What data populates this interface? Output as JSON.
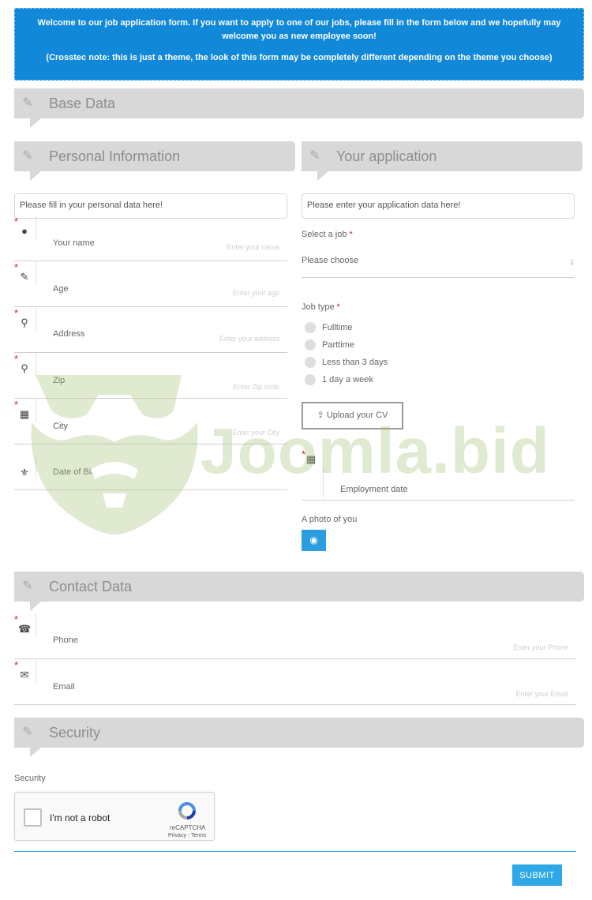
{
  "intro": {
    "line1": "Welcome to our job application form. If you want to apply to one of our jobs, please fill in the form below and we hopefully may welcome you as new employee soon!",
    "line2": "(Crosstec note: this is just a theme, the look of this form may be completely different depending on the theme you choose)"
  },
  "sections": {
    "base": "Base Data",
    "personal": "Personal Information",
    "application": "Your application",
    "contact": "Contact Data",
    "security": "Security"
  },
  "personal": {
    "note": "Please fill in your personal data here!",
    "fields": [
      {
        "label": "Your name",
        "placeholder": "Enter your name",
        "required": true,
        "icon": "user-icon"
      },
      {
        "label": "Age",
        "placeholder": "Enter your age",
        "required": true,
        "icon": "pencil-icon"
      },
      {
        "label": "Address",
        "placeholder": "Enter your address",
        "required": true,
        "icon": "map-marker-icon"
      },
      {
        "label": "Zip",
        "placeholder": "Enter Zip code",
        "required": true,
        "icon": "map-marker-icon"
      },
      {
        "label": "City",
        "placeholder": "Enter your City",
        "required": true,
        "icon": "building-icon"
      },
      {
        "label": "Date of Birth",
        "placeholder": "",
        "required": false,
        "icon": "birthday-cake-icon"
      }
    ]
  },
  "application": {
    "note": "Please enter your application data here!",
    "select_label": "Select a job",
    "select_value": "Please choose",
    "jobtype_label": "Job type",
    "job_types": [
      "Fulltime",
      "Parttime",
      "Less than 3 days",
      "1 day a week"
    ],
    "upload_label": "Upload your CV",
    "employment_label": "Employment date",
    "photo_label": "A photo of you"
  },
  "contact": {
    "fields": [
      {
        "label": "Phone",
        "placeholder": "Enter your Phone",
        "required": true,
        "icon": "phone-icon"
      },
      {
        "label": "Email",
        "placeholder": "Enter your Email",
        "required": true,
        "icon": "envelope-icon"
      }
    ]
  },
  "security": {
    "label": "Security",
    "captcha_text": "I'm not a robot",
    "captcha_brand": "reCAPTCHA",
    "captcha_terms": "Privacy - Terms"
  },
  "submit_label": "SUBMIT",
  "watermark": "Joomla.bid",
  "colors": {
    "intro_bg": "#1188d8",
    "header_bg": "#d8d8d8",
    "accent": "#2ea8e6",
    "required": "#cc2222"
  }
}
